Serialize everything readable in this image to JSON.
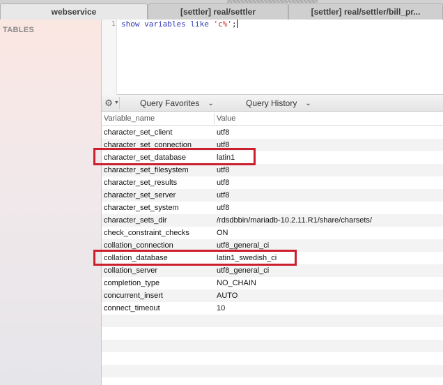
{
  "tabs": [
    {
      "label": "webservice",
      "active": true
    },
    {
      "label": "[settler] real/settler",
      "active": false
    },
    {
      "label": "[settler] real/settler/bill_pr...",
      "active": false
    }
  ],
  "sidebar": {
    "title": "TABLES"
  },
  "editor": {
    "line_number": "1",
    "query_kw": "show variables like ",
    "query_str": "'c%'",
    "query_end": ";"
  },
  "toolbar": {
    "gear_icon": "gear-icon",
    "query_favorites": "Query Favorites",
    "query_history": "Query History"
  },
  "results": {
    "columns": [
      "Variable_name",
      "Value"
    ],
    "rows": [
      {
        "name": "character_set_client",
        "value": "utf8"
      },
      {
        "name": "character_set_connection",
        "value": "utf8"
      },
      {
        "name": "character_set_database",
        "value": "latin1"
      },
      {
        "name": "character_set_filesystem",
        "value": "utf8"
      },
      {
        "name": "character_set_results",
        "value": "utf8"
      },
      {
        "name": "character_set_server",
        "value": "utf8"
      },
      {
        "name": "character_set_system",
        "value": "utf8"
      },
      {
        "name": "character_sets_dir",
        "value": "/rdsdbbin/mariadb-10.2.11.R1/share/charsets/"
      },
      {
        "name": "check_constraint_checks",
        "value": "ON"
      },
      {
        "name": "collation_connection",
        "value": "utf8_general_ci"
      },
      {
        "name": "collation_database",
        "value": "latin1_swedish_ci"
      },
      {
        "name": "collation_server",
        "value": "utf8_general_ci"
      },
      {
        "name": "completion_type",
        "value": "NO_CHAIN"
      },
      {
        "name": "concurrent_insert",
        "value": "AUTO"
      },
      {
        "name": "connect_timeout",
        "value": "10"
      }
    ]
  },
  "highlight_color": "#cc1f2d"
}
